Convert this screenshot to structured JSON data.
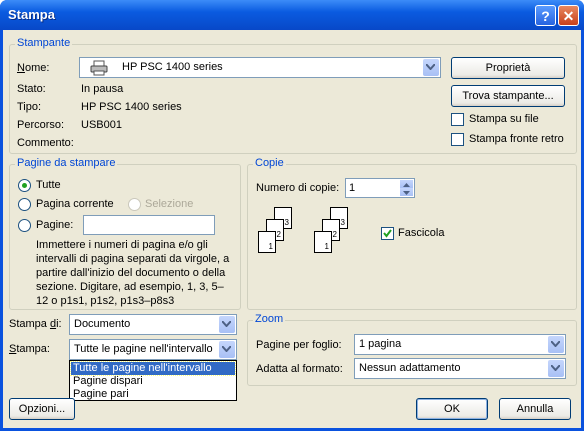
{
  "window": {
    "title": "Stampa",
    "help_label": "?",
    "close_label": "✕"
  },
  "printer": {
    "group_label": "Stampante",
    "name_label": "Nome:",
    "name_value": "HP PSC 1400 series",
    "status_label": "Stato:",
    "status_value": "In pausa",
    "type_label": "Tipo:",
    "type_value": "HP PSC 1400 series",
    "path_label": "Percorso:",
    "path_value": "USB001",
    "comment_label": "Commento:",
    "properties_button": "Proprietà",
    "find_button": "Trova stampante...",
    "print_to_file": "Stampa su file",
    "duplex": "Stampa fronte retro",
    "printer_icon": "printer-icon"
  },
  "range": {
    "group_label": "Pagine da stampare",
    "all": "Tutte",
    "current": "Pagina corrente",
    "selection": "Selezione",
    "pages": "Pagine:",
    "pages_value": "",
    "help_text": "Immettere i numeri di pagina e/o gli intervalli di pagina separati da virgole, a partire dall'inizio del documento o della sezione. Digitare, ad esempio, 1, 3, 5–12 o p1s1, p1s2, p1s3–p8s3"
  },
  "copies": {
    "group_label": "Copie",
    "count_label": "Numero di copie:",
    "count_value": "1",
    "collate": "Fascicola",
    "collate_checked": true,
    "page_numbers": [
      "1",
      "2",
      "3"
    ]
  },
  "print_what": {
    "label": "Stampa di:",
    "value": "Documento"
  },
  "print": {
    "label": "Stampa:",
    "value": "Tutte le pagine nell'intervallo",
    "options": [
      "Tutte le pagine nell'intervallo",
      "Pagine dispari",
      "Pagine pari"
    ]
  },
  "zoom": {
    "group_label": "Zoom",
    "per_sheet_label": "Pagine per foglio:",
    "per_sheet_value": "1 pagina",
    "scale_label": "Adatta al formato:",
    "scale_value": "Nessun adattamento"
  },
  "footer": {
    "options_button": "Opzioni...",
    "ok_button": "OK",
    "cancel_button": "Annulla"
  },
  "colors": {
    "title_blue": "#0A5BE0",
    "group_label": "#0046D5",
    "selection": "#316AC5",
    "face": "#ECE9D8"
  }
}
